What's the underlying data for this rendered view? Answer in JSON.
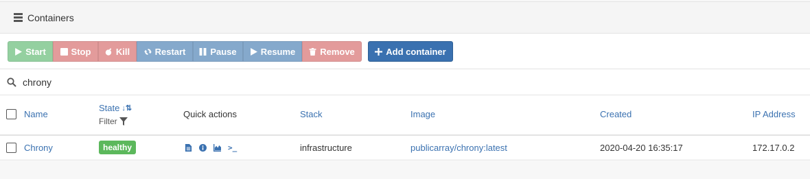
{
  "panel": {
    "title": "Containers",
    "icon": "server-icon"
  },
  "toolbar": {
    "start": "Start",
    "stop": "Stop",
    "kill": "Kill",
    "restart": "Restart",
    "pause": "Pause",
    "resume": "Resume",
    "remove": "Remove",
    "add": "Add container"
  },
  "search": {
    "value": "chrony",
    "icon": "search-icon"
  },
  "columns": {
    "name": "Name",
    "state": "State",
    "state_sort": "↓⇅",
    "filter": "Filter",
    "quick_actions": "Quick actions",
    "stack": "Stack",
    "image": "Image",
    "created": "Created",
    "ip": "IP Address"
  },
  "rows": [
    {
      "name": "Chrony",
      "state": "healthy",
      "quick_actions": [
        "logs-icon",
        "info-icon",
        "stats-icon",
        "console-icon"
      ],
      "console_label": ">_",
      "stack": "infrastructure",
      "image": "publicarray/chrony:latest",
      "created": "2020-04-20 16:35:17",
      "ip": "172.17.0.2"
    }
  ],
  "colors": {
    "start": "#94d0a0",
    "danger": "#e39b9b",
    "info": "#85a9cc",
    "primary": "#3a71b0",
    "healthy": "#5cb85c"
  }
}
